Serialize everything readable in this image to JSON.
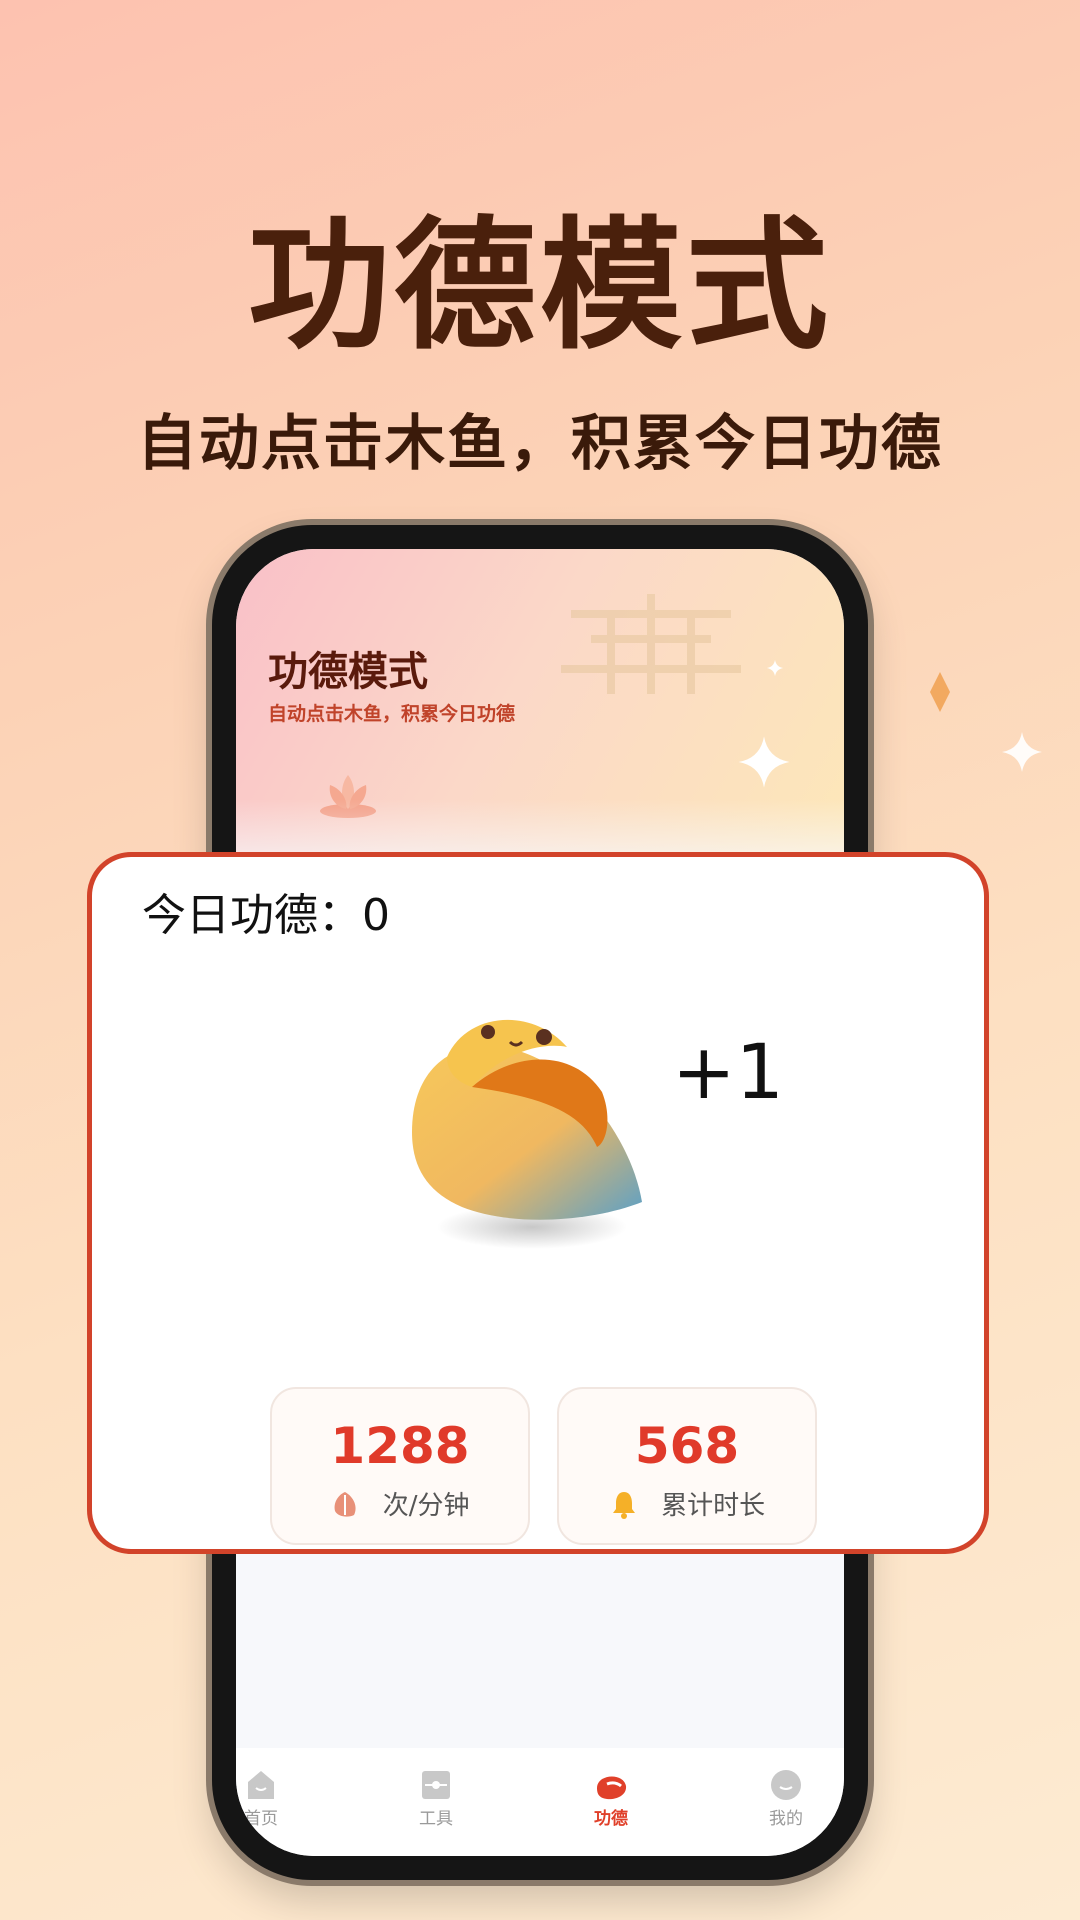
{
  "promo": {
    "title": "功德模式",
    "subtitle": "自动点击木鱼，积累今日功德"
  },
  "phone": {
    "header_title": "功德模式",
    "header_subtitle": "自动点击木鱼，积累今日功德",
    "tabs": [
      {
        "label": "首页",
        "icon": "home-icon",
        "active": false
      },
      {
        "label": "工具",
        "icon": "tool-icon",
        "active": false
      },
      {
        "label": "功德",
        "icon": "woodfish-icon",
        "active": true
      },
      {
        "label": "我的",
        "icon": "profile-icon",
        "active": false
      }
    ]
  },
  "card": {
    "merit_label": "今日功德：0",
    "increment": "+1",
    "stats": [
      {
        "value": "1288",
        "label": "次/分钟",
        "icon": "woodfish-small-icon"
      },
      {
        "value": "568",
        "label": "累计时长",
        "icon": "bell-icon"
      }
    ]
  },
  "colors": {
    "title_brown": "#4a200c",
    "accent_red": "#d2432a",
    "stat_red": "#e03a2a"
  }
}
